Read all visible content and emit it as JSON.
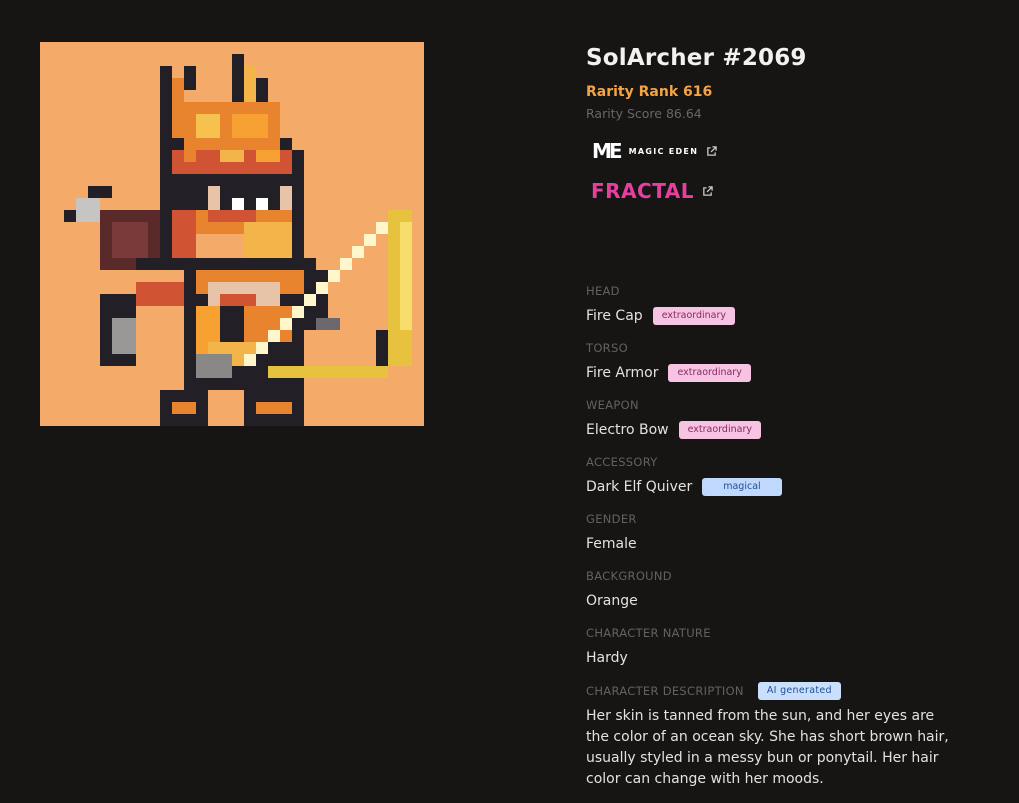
{
  "nft": {
    "title": "SolArcher #2069",
    "rarity_rank": "Rarity Rank 616",
    "rarity_score": "Rarity Score 86.64"
  },
  "colors": {
    "accent_orange": "#f3a445",
    "background": "#171414",
    "art_background": "#f4ab6a",
    "badge_extraordinary": "#f7c3e2",
    "badge_magical": "#bfd8fb",
    "fractal_pink": "#e63fa0"
  },
  "marketplaces": {
    "magic_eden": {
      "mark": "ME",
      "wordmark": "MAGIC EDEN",
      "icon": "external-link-icon"
    },
    "fractal": {
      "wordmark": "FRACTAL",
      "icon": "external-link-icon"
    }
  },
  "traits": [
    {
      "label": "HEAD",
      "value": "Fire Cap",
      "badge": "extraordinary"
    },
    {
      "label": "TORSO",
      "value": "Fire Armor",
      "badge": "extraordinary"
    },
    {
      "label": "WEAPON",
      "value": "Electro Bow",
      "badge": "extraordinary"
    },
    {
      "label": "ACCESSORY",
      "value": "Dark Elf Quiver",
      "badge": "magical"
    },
    {
      "label": "GENDER",
      "value": "Female"
    },
    {
      "label": "BACKGROUND",
      "value": "Orange"
    },
    {
      "label": "CHARACTER NATURE",
      "value": "Hardy"
    }
  ],
  "description": {
    "label": "CHARACTER DESCRIPTION",
    "badge": "AI generated",
    "text": "Her skin is tanned from the sun, and her eyes are the color of an ocean sky. She has short brown hair, usually styled in a messy bun or ponytail. Her hair color can change with her moods."
  }
}
